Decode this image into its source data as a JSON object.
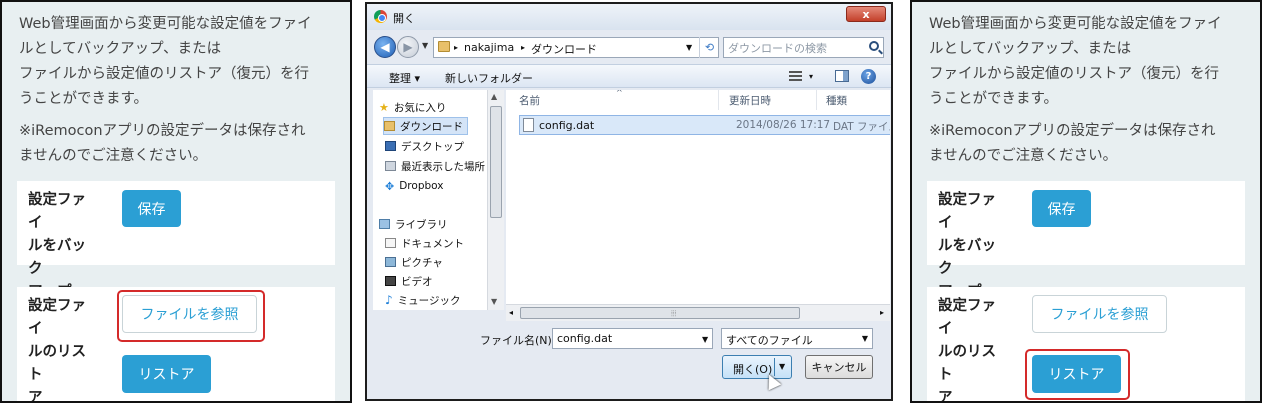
{
  "panel_left": {
    "intro": "Web管理画面から変更可能な設定値をファイ\nルとしてバックアップ、または\nファイルから設定値のリストア（復元）を行\nうことができます。",
    "note": "※iRemoconアプリの設定データは保存され\nませんのでご注意ください。",
    "backup_label": "設定ファイ\nルをバック\nアップ",
    "save_button": "保存",
    "restore_label": "設定ファイ\nルのリスト\nア",
    "browse_button": "ファイルを参照",
    "restore_button": "リストア"
  },
  "dialog": {
    "title": "開く",
    "close": "x",
    "address": [
      "nakajima",
      "ダウンロード"
    ],
    "search_placeholder": "ダウンロードの検索",
    "organize": "整理 ▾",
    "new_folder": "新しいフォルダー",
    "view_menu": "▾",
    "help": "?",
    "nav": {
      "favorites": "お気に入り",
      "downloads": "ダウンロード",
      "desktop": "デスクトップ",
      "recent": "最近表示した場所",
      "dropbox": "Dropbox",
      "libraries": "ライブラリ",
      "documents": "ドキュメント",
      "pictures": "ピクチャ",
      "videos": "ビデオ",
      "music": "ミュージック"
    },
    "columns": {
      "name": "名前",
      "date": "更新日時",
      "type": "種類"
    },
    "files": [
      {
        "name": "config.dat",
        "date": "2014/08/26 17:17",
        "type": "DAT ファイル"
      }
    ],
    "filename_label": "ファイル名(N):",
    "filename_value": "config.dat",
    "filetype": "すべてのファイル",
    "open_button": "開く(O)",
    "cancel_button": "キャンセル"
  },
  "panel_right": {
    "intro": "Web管理画面から変更可能な設定値をファイ\nルとしてバックアップ、または\nファイルから設定値のリストア（復元）を行\nうことができます。",
    "note": "※iRemoconアプリの設定データは保存され\nませんのでご注意ください。",
    "backup_label": "設定ファイ\nルをバック\nアップ",
    "save_button": "保存",
    "restore_label": "設定ファイ\nルのリスト\nア",
    "browse_button": "ファイルを参照",
    "restore_button": "リストア"
  },
  "colors": {
    "accent_blue": "#2b9fd4",
    "highlight_red": "#d42a2a",
    "panel_bg": "#e8eff1"
  }
}
